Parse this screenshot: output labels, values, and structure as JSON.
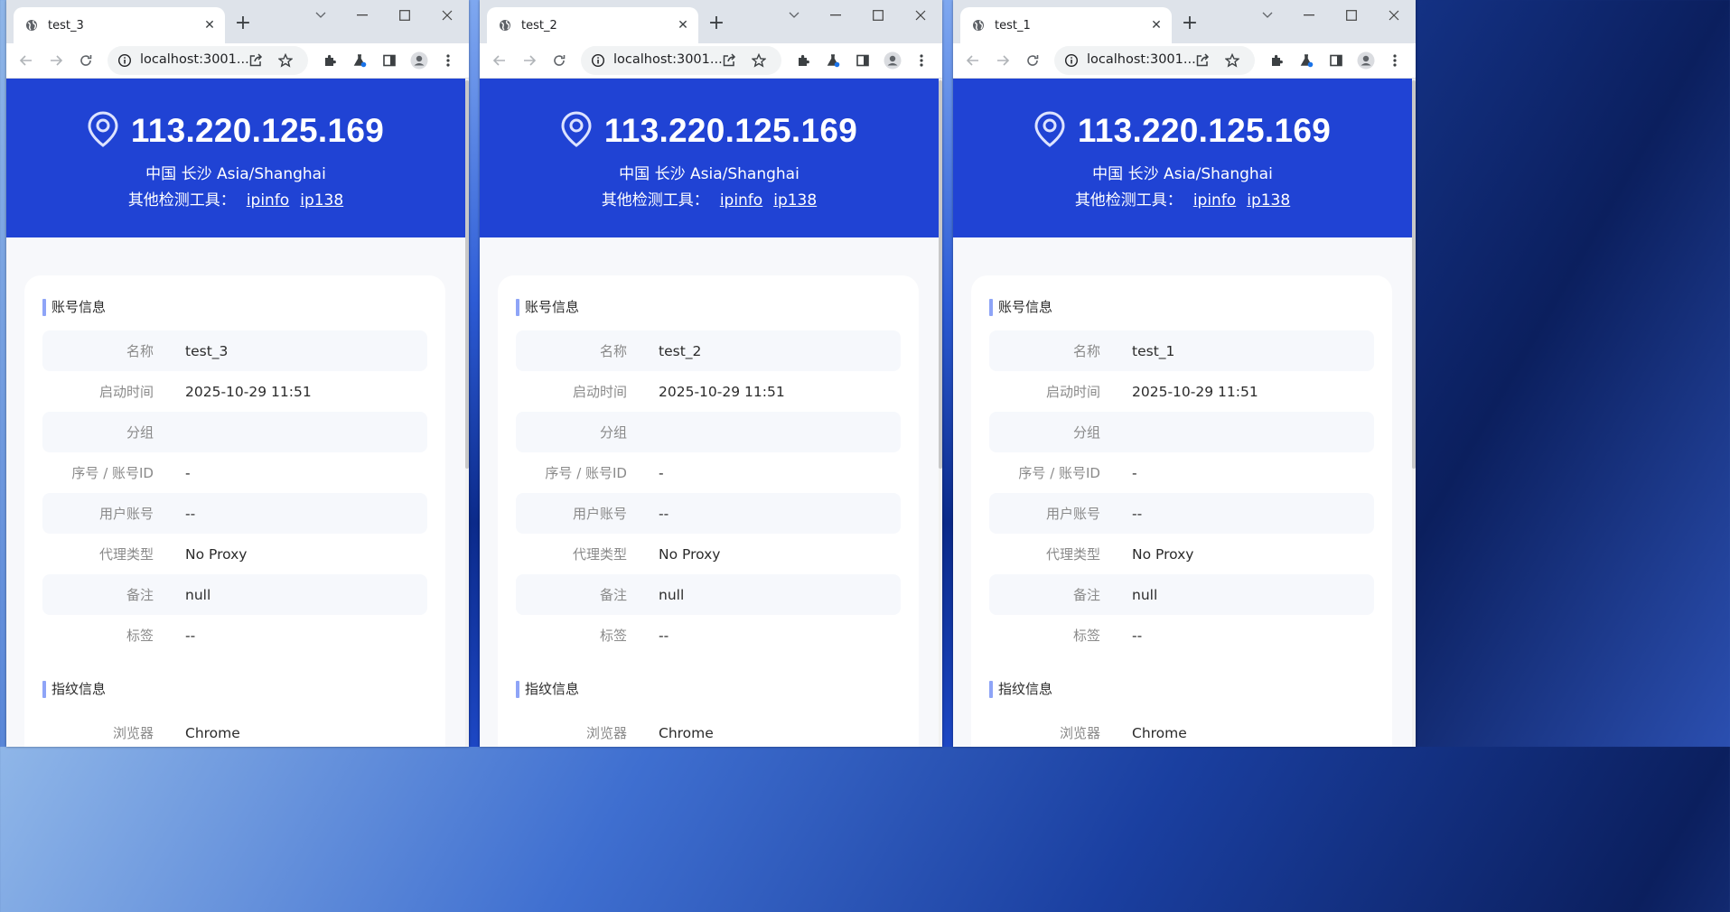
{
  "windows": [
    {
      "tab_title": "test_3",
      "url": "localhost:3001...",
      "ip": "113.220.125.169",
      "location": "中国 长沙 Asia/Shanghai",
      "tools_label": "其他检测工具：",
      "tool_links": [
        "ipinfo",
        "ip138"
      ],
      "account_section": "账号信息",
      "rows": [
        {
          "k": "名称",
          "v": "test_3"
        },
        {
          "k": "启动时间",
          "v": "2025-10-29 11:51"
        },
        {
          "k": "分组",
          "v": ""
        },
        {
          "k": "序号 / 账号ID",
          "v": "-"
        },
        {
          "k": "用户账号",
          "v": "--"
        },
        {
          "k": "代理类型",
          "v": "No Proxy"
        },
        {
          "k": "备注",
          "v": "null"
        },
        {
          "k": "标签",
          "v": "--"
        }
      ],
      "fingerprint_section": "指纹信息",
      "fp_rows": [
        {
          "k": "浏览器",
          "v": "Chrome"
        }
      ]
    },
    {
      "tab_title": "test_2",
      "url": "localhost:3001...",
      "ip": "113.220.125.169",
      "location": "中国 长沙 Asia/Shanghai",
      "tools_label": "其他检测工具：",
      "tool_links": [
        "ipinfo",
        "ip138"
      ],
      "account_section": "账号信息",
      "rows": [
        {
          "k": "名称",
          "v": "test_2"
        },
        {
          "k": "启动时间",
          "v": "2025-10-29 11:51"
        },
        {
          "k": "分组",
          "v": ""
        },
        {
          "k": "序号 / 账号ID",
          "v": "-"
        },
        {
          "k": "用户账号",
          "v": "--"
        },
        {
          "k": "代理类型",
          "v": "No Proxy"
        },
        {
          "k": "备注",
          "v": "null"
        },
        {
          "k": "标签",
          "v": "--"
        }
      ],
      "fingerprint_section": "指纹信息",
      "fp_rows": [
        {
          "k": "浏览器",
          "v": "Chrome"
        }
      ]
    },
    {
      "tab_title": "test_1",
      "url": "localhost:3001...",
      "ip": "113.220.125.169",
      "location": "中国 长沙 Asia/Shanghai",
      "tools_label": "其他检测工具：",
      "tool_links": [
        "ipinfo",
        "ip138"
      ],
      "account_section": "账号信息",
      "rows": [
        {
          "k": "名称",
          "v": "test_1"
        },
        {
          "k": "启动时间",
          "v": "2025-10-29 11:51"
        },
        {
          "k": "分组",
          "v": ""
        },
        {
          "k": "序号 / 账号ID",
          "v": "-"
        },
        {
          "k": "用户账号",
          "v": "--"
        },
        {
          "k": "代理类型",
          "v": "No Proxy"
        },
        {
          "k": "备注",
          "v": "null"
        },
        {
          "k": "标签",
          "v": "--"
        }
      ],
      "fingerprint_section": "指纹信息",
      "fp_rows": [
        {
          "k": "浏览器",
          "v": "Chrome"
        }
      ]
    }
  ],
  "colors": {
    "hero": "#2043d4",
    "accent_bar": "#8ea4f7",
    "row_alt": "#f6f8fc"
  },
  "icons": [
    "globe-icon",
    "close-icon",
    "plus-icon",
    "chevron-down-icon",
    "minimize-icon",
    "maximize-icon",
    "close-window-icon",
    "back-icon",
    "forward-icon",
    "reload-icon",
    "info-icon",
    "share-icon",
    "star-icon",
    "extensions-icon",
    "flask-icon",
    "sidepanel-icon",
    "profile-icon",
    "menu-icon",
    "map-pin-icon"
  ]
}
